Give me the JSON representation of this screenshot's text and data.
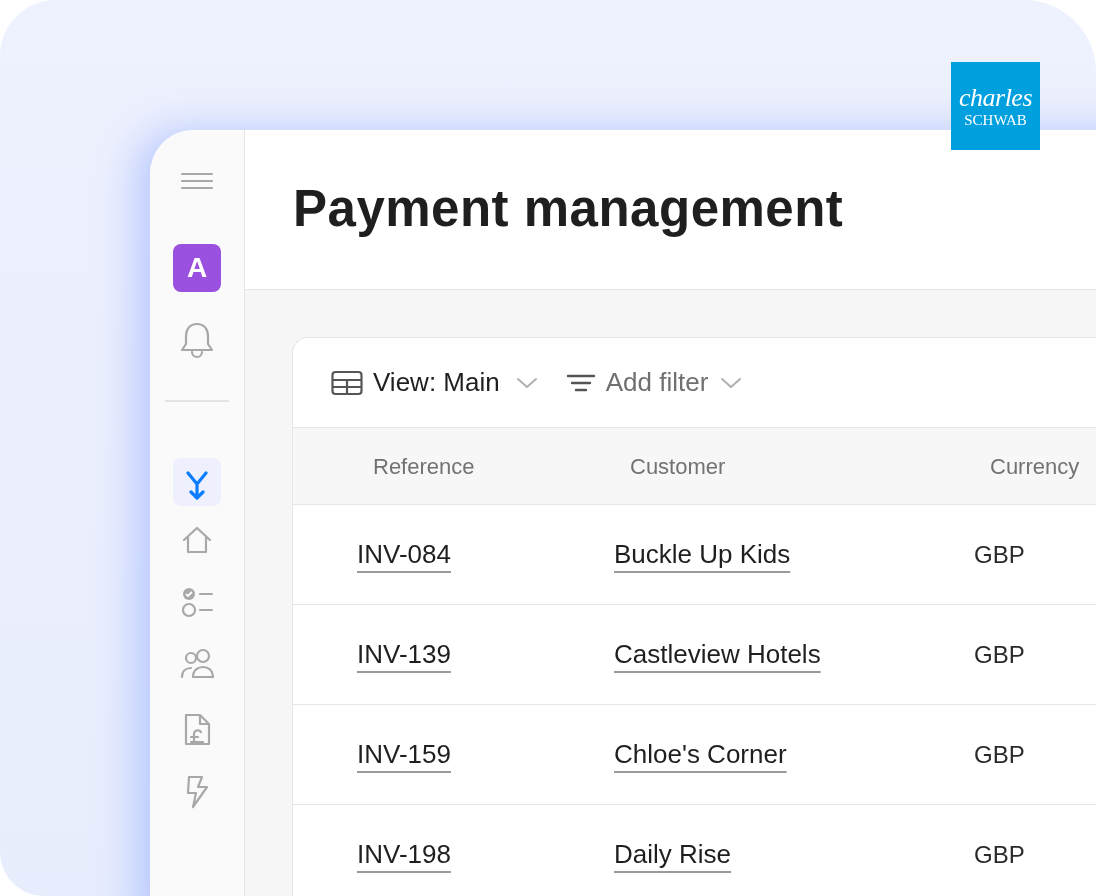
{
  "logo": {
    "line_1": "charles",
    "line_2": "SCHWAB"
  },
  "sidebar": {
    "avatar": "A",
    "nav_items": [
      {
        "kind": "flows",
        "selected": true
      },
      {
        "kind": "home",
        "selected": false
      },
      {
        "kind": "tasks",
        "selected": false
      },
      {
        "kind": "customers",
        "selected": false
      },
      {
        "kind": "invoices",
        "selected": false
      },
      {
        "kind": "automations",
        "selected": false
      }
    ]
  },
  "page_title": "Payment management",
  "toolbar": {
    "view": "View: Main",
    "filter": "Add filter"
  },
  "table": {
    "columns": [
      "Reference",
      "Customer",
      "Currency"
    ],
    "rows": [
      {
        "reference": "INV-084",
        "customer": "Buckle Up Kids",
        "currency": "GBP"
      },
      {
        "reference": "INV-139",
        "customer": "Castleview Hotels",
        "currency": "GBP"
      },
      {
        "reference": "INV-159",
        "customer": "Chloe's Corner",
        "currency": "GBP"
      },
      {
        "reference": "INV-198",
        "customer": "Daily Rise",
        "currency": "GBP"
      }
    ]
  }
}
